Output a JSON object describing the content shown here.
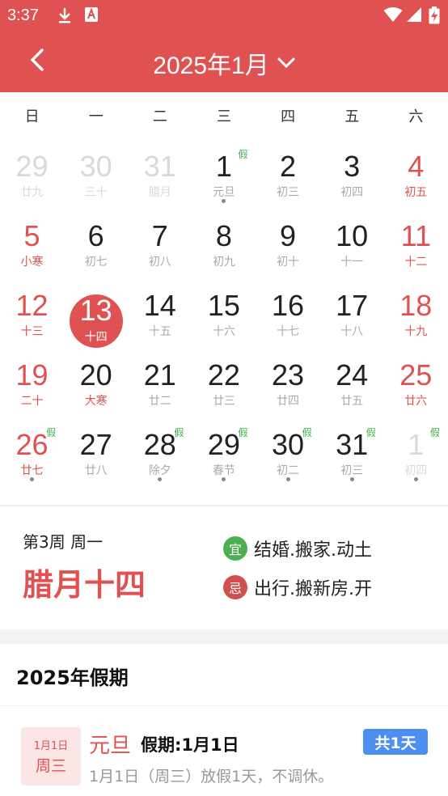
{
  "status_bar": {
    "time": "3:37"
  },
  "header": {
    "title": "2025年1月"
  },
  "weekdays": [
    "日",
    "一",
    "二",
    "三",
    "四",
    "五",
    "六"
  ],
  "calendar": {
    "weeks": [
      [
        {
          "day": "29",
          "lunar": "廿九",
          "other": true
        },
        {
          "day": "30",
          "lunar": "三十",
          "other": true
        },
        {
          "day": "31",
          "lunar": "腊月",
          "other": true
        },
        {
          "day": "1",
          "lunar": "元旦",
          "holiday": "假",
          "dot": true
        },
        {
          "day": "2",
          "lunar": "初三"
        },
        {
          "day": "3",
          "lunar": "初四"
        },
        {
          "day": "4",
          "lunar": "初五",
          "weekend": true
        }
      ],
      [
        {
          "day": "5",
          "lunar": "小寒",
          "weekend": true
        },
        {
          "day": "6",
          "lunar": "初七"
        },
        {
          "day": "7",
          "lunar": "初八"
        },
        {
          "day": "8",
          "lunar": "初九"
        },
        {
          "day": "9",
          "lunar": "初十"
        },
        {
          "day": "10",
          "lunar": "十一"
        },
        {
          "day": "11",
          "lunar": "十二",
          "weekend": true
        }
      ],
      [
        {
          "day": "12",
          "lunar": "十三",
          "weekend": true
        },
        {
          "day": "13",
          "lunar": "十四",
          "selected": true
        },
        {
          "day": "14",
          "lunar": "十五"
        },
        {
          "day": "15",
          "lunar": "十六"
        },
        {
          "day": "16",
          "lunar": "十七"
        },
        {
          "day": "17",
          "lunar": "十八"
        },
        {
          "day": "18",
          "lunar": "十九",
          "weekend": true
        }
      ],
      [
        {
          "day": "19",
          "lunar": "二十",
          "weekend": true
        },
        {
          "day": "20",
          "lunar": "大寒",
          "term": true
        },
        {
          "day": "21",
          "lunar": "廿二"
        },
        {
          "day": "22",
          "lunar": "廿三"
        },
        {
          "day": "23",
          "lunar": "廿四"
        },
        {
          "day": "24",
          "lunar": "廿五"
        },
        {
          "day": "25",
          "lunar": "廿六",
          "weekend": true
        }
      ],
      [
        {
          "day": "26",
          "lunar": "廿七",
          "weekend": true,
          "holiday": "假",
          "dot": true
        },
        {
          "day": "27",
          "lunar": "廿八"
        },
        {
          "day": "28",
          "lunar": "除夕",
          "holiday": "假",
          "dot": true
        },
        {
          "day": "29",
          "lunar": "春节",
          "holiday": "假",
          "dot": true
        },
        {
          "day": "30",
          "lunar": "初二",
          "holiday": "假",
          "dot": true
        },
        {
          "day": "31",
          "lunar": "初三",
          "holiday": "假",
          "dot": true
        },
        {
          "day": "1",
          "lunar": "初四",
          "other": true,
          "holiday": "假",
          "dot": true
        }
      ]
    ]
  },
  "info": {
    "week_text": "第3周 周一",
    "lunar_date": "腊月十四",
    "yi_label": "宜",
    "yi_text": "结婚.搬家.动土",
    "ji_label": "忌",
    "ji_text": "出行.搬新房.开",
    "yi_color": "#4caf50",
    "ji_color": "#d05050"
  },
  "holidays_section": {
    "title": "2025年假期",
    "items": [
      {
        "date": "1月1日",
        "weekday": "周三",
        "name": "元旦",
        "period": "假期:1月1日",
        "total": "共1天",
        "desc": "1月1日（周三）放假1天，不调休。"
      }
    ]
  },
  "colors": {
    "accent": "#e05252",
    "holiday_green": "#3cb04a",
    "badge_blue": "#4d8ff0"
  }
}
